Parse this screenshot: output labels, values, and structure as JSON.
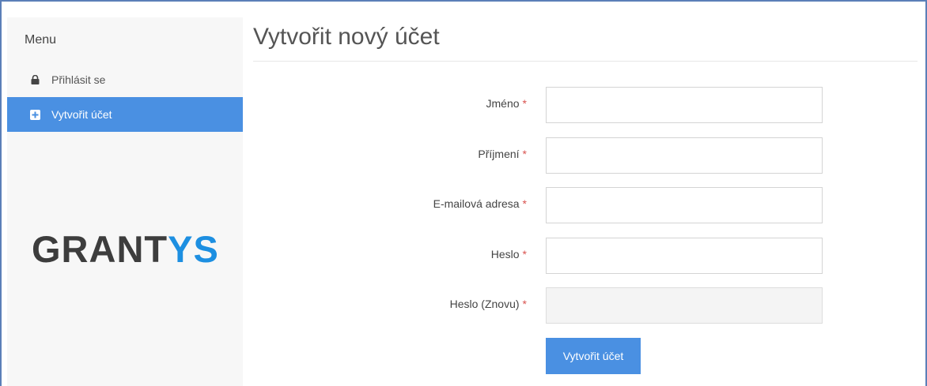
{
  "sidebar": {
    "title": "Menu",
    "items": [
      {
        "label": "Přihlásit se",
        "icon": "lock-icon"
      },
      {
        "label": "Vytvořit účet",
        "icon": "plus-square-icon"
      }
    ],
    "logo": {
      "part1": "GRANT",
      "part2": "YS"
    }
  },
  "main": {
    "title": "Vytvořit nový účet",
    "required_marker": "*",
    "fields": [
      {
        "label": "Jméno",
        "value": "",
        "placeholder": ""
      },
      {
        "label": "Příjmení",
        "value": "",
        "placeholder": ""
      },
      {
        "label": "E-mailová adresa",
        "value": "",
        "placeholder": ""
      },
      {
        "label": "Heslo",
        "value": "",
        "placeholder": ""
      },
      {
        "label": "Heslo (Znovu)",
        "value": "",
        "placeholder": ""
      }
    ],
    "submit_label": "Vytvořit účet"
  },
  "colors": {
    "accent": "#4a90e2",
    "logo_blue": "#1d8fe1",
    "required": "#d9534f"
  }
}
